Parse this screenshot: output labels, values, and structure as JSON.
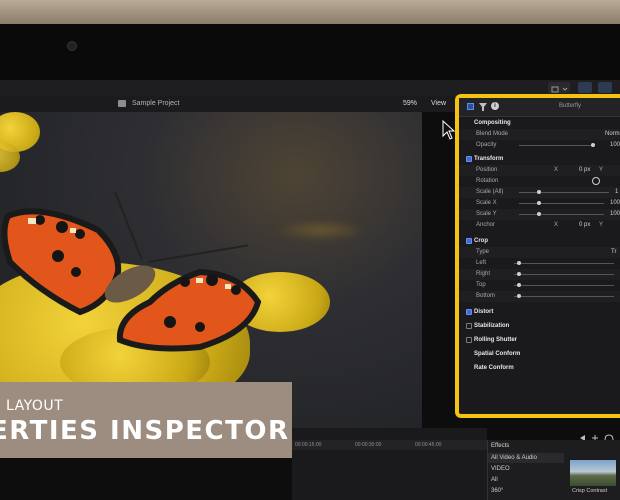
{
  "viewer": {
    "project_name": "Sample Project",
    "zoom": "59%",
    "view_menu": "View"
  },
  "inspector": {
    "title": "Butterfly",
    "sections": {
      "compositing": {
        "label": "Compositing",
        "blend_mode_label": "Blend Mode",
        "blend_mode_value": "Norm",
        "opacity_label": "Opacity",
        "opacity_value": "100"
      },
      "transform": {
        "label": "Transform",
        "position_label": "Position",
        "position_x_label": "X",
        "position_x_value": "0 px",
        "position_y_label": "Y",
        "rotation_label": "Rotation",
        "scale_all_label": "Scale (All)",
        "scale_all_value": "1",
        "scale_x_label": "Scale X",
        "scale_x_value": "100",
        "scale_y_label": "Scale Y",
        "scale_y_value": "100",
        "anchor_label": "Anchor",
        "anchor_x_label": "X",
        "anchor_x_value": "0 px",
        "anchor_y_label": "Y"
      },
      "crop": {
        "label": "Crop",
        "type_label": "Type",
        "type_value": "Tr",
        "left_label": "Left",
        "right_label": "Right",
        "top_label": "Top",
        "bottom_label": "Bottom"
      },
      "distort": {
        "label": "Distort"
      },
      "stabilization": {
        "label": "Stabilization"
      },
      "rolling_shutter": {
        "label": "Rolling Shutter"
      },
      "spatial_conform": {
        "label": "Spatial Conform"
      },
      "rate_conform": {
        "label": "Rate Conform"
      }
    }
  },
  "lower_third": {
    "line1": "LAYOUT",
    "line2": "ERTIES INSPECTOR"
  },
  "timeline": {
    "timecodes": [
      "00:00:15:00",
      "00:00:30:00",
      "00:00:45:00"
    ]
  },
  "effects": {
    "title": "Effects",
    "items": [
      "All Video & Audio",
      "VIDEO",
      "All",
      "360°"
    ],
    "thumbnail_label": "Crisp Contrast"
  },
  "colors": {
    "highlight": "#f2c40f",
    "checkbox_on": "#3c6ddb",
    "lower_third_bg": "#9c8d80"
  }
}
